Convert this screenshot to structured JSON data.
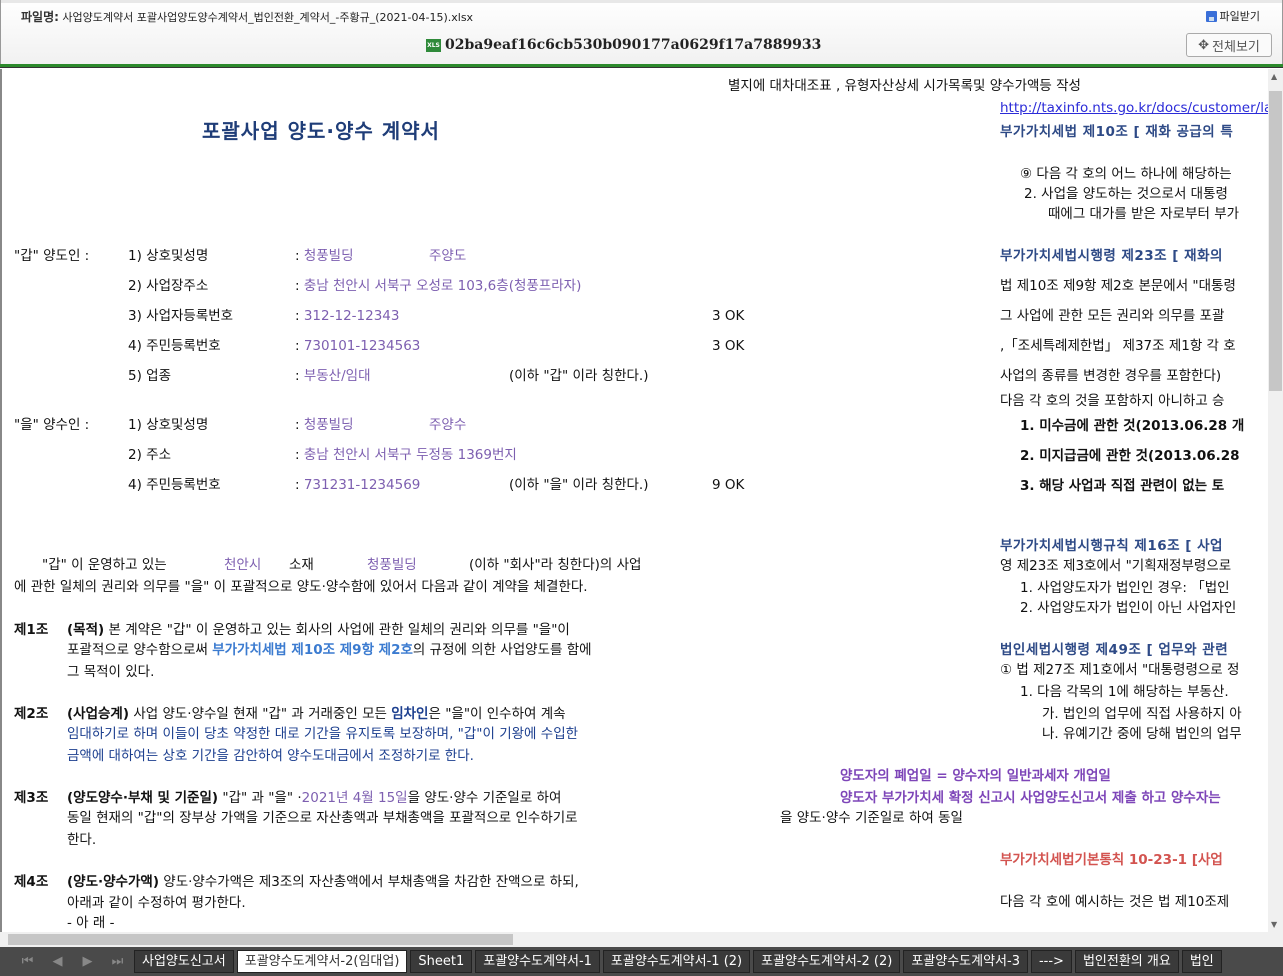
{
  "header": {
    "file_label": "파일명:",
    "file_name": "사업양도계약서 포괄사업양도양수계약서_법인전환_계약서_-주황규_(2021-04-15).xlsx",
    "download_label": "파일받기",
    "hash": "02ba9eaf16c6cb530b090177a0629f17a7889933",
    "xls_badge": "XLS",
    "full_view_label": "전체보기"
  },
  "doc": {
    "lines": [
      [
        {
          "t": "별지에 대차대조표 , 유형자산상세 시가목록및 양수가액등 작성"
        }
      ],
      [
        {
          "t": "포괄사업 양도·양수 계약서",
          "s": "title"
        }
      ],
      [
        {
          "t": "\"갑\" 양도인 :"
        }
      ],
      [
        {
          "t": "1) 상호및성명"
        }
      ],
      [
        {
          "t": ": "
        },
        {
          "t": "청풍빌딩",
          "s": "purple"
        }
      ],
      [
        {
          "t": "주양도",
          "s": "purple"
        }
      ],
      [
        {
          "t": "2) 사업장주소"
        }
      ],
      [
        {
          "t": ": "
        },
        {
          "t": "충남 천안시 서북구 오성로 103,6층(청풍프라자)",
          "s": "purple"
        }
      ],
      [
        {
          "t": "3) 사업자등록번호"
        }
      ],
      [
        {
          "t": ": "
        },
        {
          "t": "312-12-12343",
          "s": "purple"
        }
      ],
      [
        {
          "t": "3   OK"
        }
      ],
      [
        {
          "t": "4) 주민등록번호"
        }
      ],
      [
        {
          "t": ": "
        },
        {
          "t": "730101-1234563",
          "s": "purple"
        }
      ],
      [
        {
          "t": "3   OK"
        }
      ],
      [
        {
          "t": "5) 업종"
        }
      ],
      [
        {
          "t": ": "
        },
        {
          "t": "부동산/임대",
          "s": "purple"
        }
      ],
      [
        {
          "t": "(이하 \"갑\" 이라 칭한다.)"
        }
      ],
      [
        {
          "t": "\"을\" 양수인 :"
        }
      ],
      [
        {
          "t": "1) 상호및성명"
        }
      ],
      [
        {
          "t": ": "
        },
        {
          "t": "청풍빌딩",
          "s": "purple"
        }
      ],
      [
        {
          "t": "주양수",
          "s": "purple"
        }
      ],
      [
        {
          "t": "2) 주소"
        }
      ],
      [
        {
          "t": ": "
        },
        {
          "t": "충남 천안시 서북구 두정동 1369번지",
          "s": "purple"
        }
      ],
      [
        {
          "t": "4) 주민등록번호"
        }
      ],
      [
        {
          "t": ": "
        },
        {
          "t": "731231-1234569",
          "s": "purple"
        }
      ],
      [
        {
          "t": "(이하 \"을\" 이라 칭한다.)"
        }
      ],
      [
        {
          "t": "9   OK"
        }
      ],
      [
        {
          "t": "\"갑\" 이 운영하고 있는"
        }
      ],
      [
        {
          "t": "천안시",
          "s": "purple"
        }
      ],
      [
        {
          "t": "소재"
        }
      ],
      [
        {
          "t": "청풍빌딩",
          "s": "purple"
        }
      ],
      [
        {
          "t": "(이하 \"회사\"라 칭한다)의 사업"
        }
      ],
      [
        {
          "t": "에 관한 일체의 권리와 의무를 \"을\" 이 포괄적으로 양도·양수함에 있어서 다음과 같이 계약을 체결한다."
        }
      ],
      [
        {
          "t": "제1조",
          "s": "b"
        }
      ],
      [
        {
          "t": "(목적)",
          "s": "b"
        },
        {
          "t": " 본 계약은 \"갑\" 이 운영하고 있는 회사의 사업에 관한 일체의 권리와 의무를 \"을\"이"
        }
      ],
      [
        {
          "t": "포괄적으로 양수함으로써 "
        },
        {
          "t": "부가가치세법 제10조 제9항 제2호",
          "s": "blue"
        },
        {
          "t": "의 규정에 의한 사업양도를 함에"
        }
      ],
      [
        {
          "t": "그 목적이 있다."
        }
      ],
      [
        {
          "t": "제2조",
          "s": "b"
        }
      ],
      [
        {
          "t": "(사업승계)",
          "s": "b"
        },
        {
          "t": " 사업 양도·양수일 현재 \"갑\" 과 거래중인 모든 "
        },
        {
          "t": "임차인",
          "s": "navyb"
        },
        {
          "t": "은 \"을\"이 인수하여 계속"
        }
      ],
      [
        {
          "t": "임대하기로 하며 이들이 당초 약정한 대로 기간을 유지토록 보장하며, \"갑\"이 기왕에 수입한",
          "s": "navy"
        }
      ],
      [
        {
          "t": "금액에 대하여는 상호 기간을 감안하여 양수도대금에서 조정하기로 한다.",
          "s": "navy"
        }
      ],
      [
        {
          "t": "제3조",
          "s": "b"
        }
      ],
      [
        {
          "t": "(양도양수·부채 및 기준일)",
          "s": "b"
        },
        {
          "t": " \"갑\" 과 \"을\" ·"
        },
        {
          "t": "2021년 4월 15일",
          "s": "purple"
        },
        {
          "t": "을 양도·양수 기준일로 하여"
        }
      ],
      [
        {
          "t": "동일 현재의 \"갑\"의 장부상 가액을 기준으로 자산총액과 부채총액을 포괄적으로 인수하기로"
        }
      ],
      [
        {
          "t": "한다."
        }
      ],
      [
        {
          "t": "제4조",
          "s": "b"
        }
      ],
      [
        {
          "t": "(양도·양수가액)",
          "s": "b"
        },
        {
          "t": " 양도·양수가액은 제3조의 자산총액에서 부채총액을 차감한 잔액으로 하되,"
        }
      ],
      [
        {
          "t": "아래과 같이 수정하여 평가한다."
        }
      ],
      [
        {
          "t": "- 아 래 -"
        }
      ],
      [
        {
          "t": "http://taxinfo.nts.go.kr/docs/customer/la",
          "s": "link"
        }
      ],
      [
        {
          "t": "부가가치세법 제10조 [ 재화 공급의 특",
          "s": "heading"
        }
      ],
      [
        {
          "t": "⑨ 다음 각 호의 어느 하나에 해당하는"
        }
      ],
      [
        {
          "t": "2. 사업을 양도하는 것으로서 대통령"
        }
      ],
      [
        {
          "t": "때에그 대가를 받은 자로부터 부가"
        }
      ],
      [
        {
          "t": "부가가치세법시행령 제23조 [ 재화의",
          "s": "heading"
        }
      ],
      [
        {
          "t": "법 제10조 제9항 제2호 본문에서 \"대통령"
        }
      ],
      [
        {
          "t": "그 사업에 관한 모든 권리와 의무를 포괄"
        }
      ],
      [
        {
          "t": ",「조세특례제한법」 제37조 제1항 각 호"
        }
      ],
      [
        {
          "t": "사업의 종류를 변경한 경우를 포함한다)"
        }
      ],
      [
        {
          "t": "다음 각 호의 것을 포함하지 아니하고 승"
        }
      ],
      [
        {
          "t": "1. 미수금에 관한 것(2013.06.28 개",
          "s": "b"
        }
      ],
      [
        {
          "t": "2. 미지급금에 관한 것(2013.06.28",
          "s": "b"
        }
      ],
      [
        {
          "t": "3. 해당 사업과 직접 관련이 없는 토",
          "s": "b"
        }
      ],
      [
        {
          "t": "부가가치세법시행규칙 제16조 [ 사업",
          "s": "heading"
        }
      ],
      [
        {
          "t": "영 제23조 제3호에서 \"기획재정부령으로"
        }
      ],
      [
        {
          "t": "1. 사업양도자가 법인인 경우: 「법인"
        }
      ],
      [
        {
          "t": "2. 사업양도자가 법인이 아닌 사업자인"
        }
      ],
      [
        {
          "t": "법인세법시행령 제49조 [ 업무와 관련",
          "s": "heading"
        }
      ],
      [
        {
          "t": "① 법 제27조 제1호에서 \"대통령령으로 정"
        }
      ],
      [
        {
          "t": "1. 다음 각목의 1에 해당하는 부동산."
        }
      ],
      [
        {
          "t": "가. 법인의 업무에 직접 사용하지 아"
        }
      ],
      [
        {
          "t": "나. 유예기간 중에 당해 법인의 업무"
        }
      ],
      [
        {
          "t": "양도자의 폐업일 = 양수자의 일반과세자 개업일",
          "s": "purpleb"
        }
      ],
      [
        {
          "t": "양도자 부가가치세 확정 신고시 사업양도신고서 제출 하고 양수자는",
          "s": "purpleb"
        }
      ],
      [
        {
          "t": "을 양도·양수 기준일로 하여 동일"
        }
      ],
      [
        {
          "t": "부가가치세법기본통칙 10-23-1 [사업",
          "s": "red"
        }
      ],
      [
        {
          "t": "다음 각 호에 예시하는 것은 법 제10조제"
        }
      ]
    ]
  },
  "sheet_tabs": [
    "사업양도신고서",
    "포괄양수도계약서-2(임대업)",
    "Sheet1",
    "포괄양수도계약서-1",
    "포괄양수도계약서-1 (2)",
    "포괄양수도계약서-2 (2)",
    "포괄양수도계약서-3",
    "--->",
    "법인전환의 개요",
    "법인"
  ],
  "active_tab": 1
}
